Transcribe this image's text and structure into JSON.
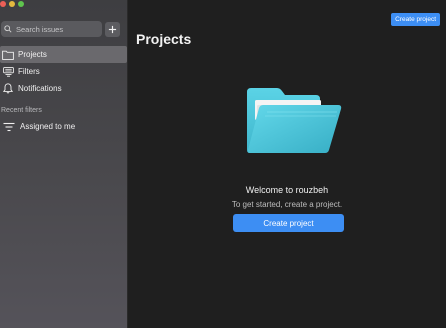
{
  "sidebar": {
    "search": {
      "placeholder": "Search issues"
    },
    "add_label": "+",
    "items": [
      {
        "label": "Projects",
        "icon": "folder-icon",
        "active": true
      },
      {
        "label": "Filters",
        "icon": "filter-icon",
        "active": false
      },
      {
        "label": "Notifications",
        "icon": "bell-icon",
        "active": false
      }
    ],
    "recent_filters_label": "Recent filters",
    "recent": [
      {
        "label": "Assigned to me",
        "icon": "filter-lines-icon"
      }
    ]
  },
  "main": {
    "top_button_label": "Create project",
    "title": "Projects",
    "welcome": "Welcome to rouzbeh",
    "subtext": "To get started, create a project.",
    "create_button_label": "Create project"
  },
  "colors": {
    "accent": "#3d8ef3",
    "folder": "#4cc6da",
    "background": "#1f1f1f"
  }
}
